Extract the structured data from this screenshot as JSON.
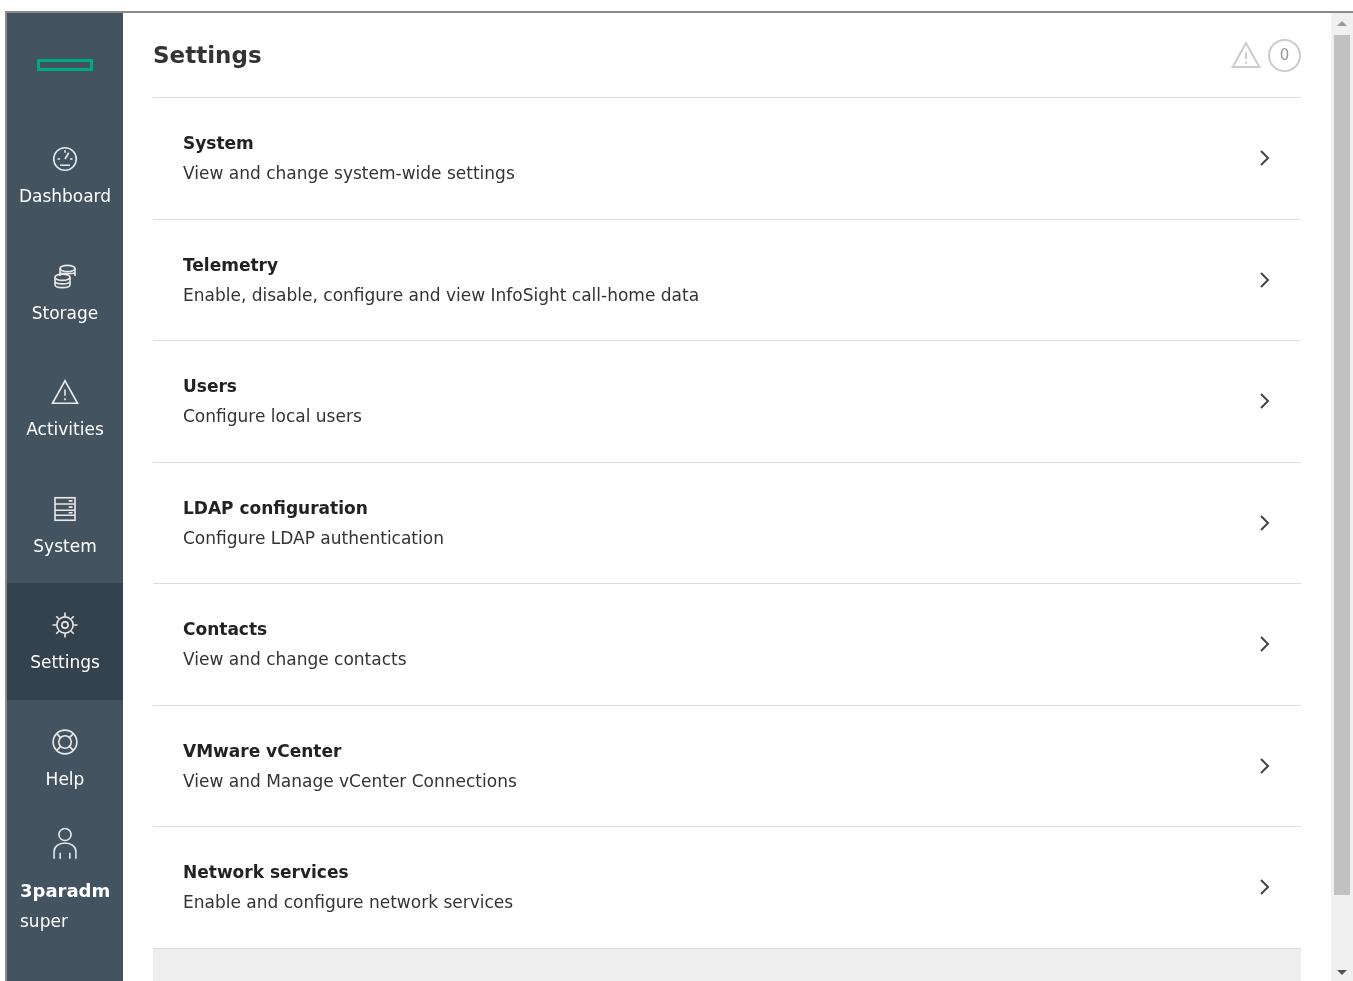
{
  "sidebar": {
    "items": [
      {
        "label": "Dashboard",
        "selected": false
      },
      {
        "label": "Storage",
        "selected": false
      },
      {
        "label": "Activities",
        "selected": false
      },
      {
        "label": "System",
        "selected": false
      },
      {
        "label": "Settings",
        "selected": true
      },
      {
        "label": "Help",
        "selected": false
      }
    ],
    "user": {
      "name": "3paradm",
      "role": "super"
    }
  },
  "header": {
    "title": "Settings",
    "alert_count": "0"
  },
  "settings": [
    {
      "title": "System",
      "description": "View and change system-wide settings"
    },
    {
      "title": "Telemetry",
      "description": "Enable, disable, configure and view InfoSight call-home data"
    },
    {
      "title": "Users",
      "description": "Configure local users"
    },
    {
      "title": "LDAP configuration",
      "description": "Configure LDAP authentication"
    },
    {
      "title": "Contacts",
      "description": "View and change contacts"
    },
    {
      "title": "VMware vCenter",
      "description": "View and Manage vCenter Connections"
    },
    {
      "title": "Network services",
      "description": "Enable and configure network services"
    }
  ]
}
